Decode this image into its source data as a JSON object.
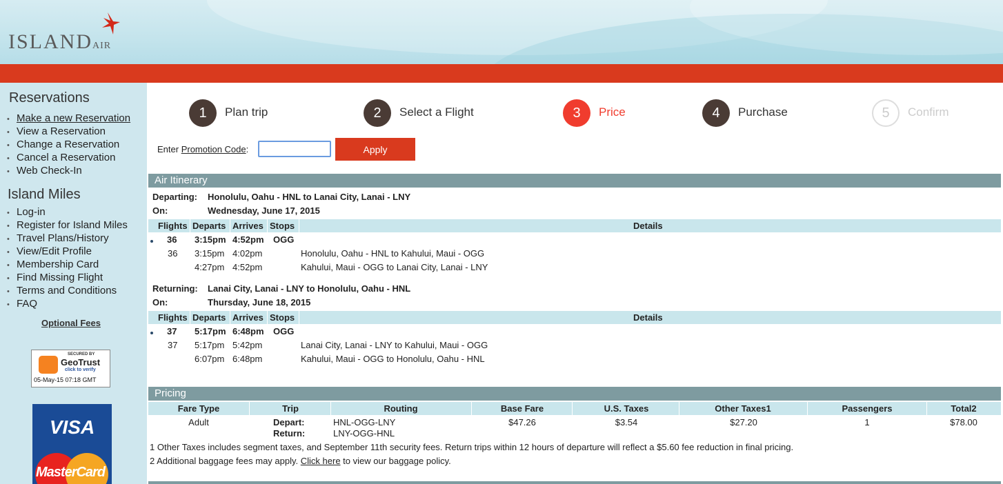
{
  "header": {
    "logo_main": "ISLAND",
    "logo_sub": "AIR"
  },
  "sidebar": {
    "reservations_heading": "Reservations",
    "reservations": [
      "Make a new Reservation",
      "View a Reservation",
      "Change a Reservation",
      "Cancel a Reservation",
      "Web Check-In"
    ],
    "miles_heading": "Island Miles",
    "miles": [
      "Log-in",
      "Register for Island Miles",
      "Travel Plans/History",
      "View/Edit Profile",
      "Membership Card",
      "Find Missing Flight",
      "Terms and Conditions",
      "FAQ"
    ],
    "optional_fees": "Optional Fees",
    "geotrust": {
      "top": "SECURED BY",
      "name": "GeoTrust",
      "verify": "click to verify",
      "date": "05-May-15 07:18 GMT"
    },
    "visa": "VISA",
    "mastercard": "MasterCard"
  },
  "steps": [
    {
      "num": "1",
      "label": "Plan trip",
      "state": "done"
    },
    {
      "num": "2",
      "label": "Select a Flight",
      "state": "done"
    },
    {
      "num": "3",
      "label": "Price",
      "state": "active"
    },
    {
      "num": "4",
      "label": "Purchase",
      "state": "done"
    },
    {
      "num": "5",
      "label": "Confirm",
      "state": "disabled"
    }
  ],
  "promo": {
    "label_prefix": "Enter ",
    "label_link": "Promotion Code",
    "label_suffix": ":",
    "value": "",
    "apply": "Apply"
  },
  "itinerary": {
    "heading": "Air Itinerary",
    "col_headers": {
      "flights": "Flights",
      "departs": "Departs",
      "arrives": "Arrives",
      "stops": "Stops",
      "details": "Details"
    },
    "departing": {
      "label": "Departing:",
      "route": "Honolulu, Oahu - HNL to Lanai City, Lanai - LNY",
      "on_label": "On:",
      "date": "Wednesday, June 17, 2015",
      "main": {
        "flight": "36",
        "departs": "3:15pm",
        "arrives": "4:52pm",
        "stops": "OGG"
      },
      "legs": [
        {
          "flight": "36",
          "departs": "3:15pm",
          "arrives": "4:02pm",
          "details": "Honolulu, Oahu - HNL to Kahului, Maui - OGG"
        },
        {
          "flight": "",
          "departs": "4:27pm",
          "arrives": "4:52pm",
          "details": "Kahului, Maui - OGG to Lanai City, Lanai - LNY"
        }
      ]
    },
    "returning": {
      "label": "Returning:",
      "route": "Lanai City, Lanai - LNY to Honolulu, Oahu - HNL",
      "on_label": "On:",
      "date": "Thursday, June 18, 2015",
      "main": {
        "flight": "37",
        "departs": "5:17pm",
        "arrives": "6:48pm",
        "stops": "OGG"
      },
      "legs": [
        {
          "flight": "37",
          "departs": "5:17pm",
          "arrives": "5:42pm",
          "details": "Lanai City, Lanai - LNY to Kahului, Maui - OGG"
        },
        {
          "flight": "",
          "departs": "6:07pm",
          "arrives": "6:48pm",
          "details": "Kahului, Maui - OGG to Honolulu, Oahu - HNL"
        }
      ]
    }
  },
  "pricing": {
    "heading": "Pricing",
    "headers": {
      "fare_type": "Fare Type",
      "trip": "Trip",
      "routing": "Routing",
      "base_fare": "Base Fare",
      "us_taxes": "U.S. Taxes",
      "other_taxes": "Other Taxes1",
      "passengers": "Passengers",
      "total": "Total2"
    },
    "row": {
      "fare_type": "Adult",
      "trip_depart": "Depart:",
      "trip_return": "Return:",
      "routing_depart": "HNL-OGG-LNY",
      "routing_return": "LNY-OGG-HNL",
      "base_fare": "$47.26",
      "us_taxes": "$3.54",
      "other_taxes": "$27.20",
      "passengers": "1",
      "total": "$78.00"
    },
    "note1": "1 Other Taxes includes segment taxes, and September 11th security fees. Return trips within 12 hours of departure will reflect a $5.60 fee reduction in final pricing.",
    "note2_prefix": "2 Additional baggage fees may apply. ",
    "note2_link": "Click here",
    "note2_suffix": " to view our baggage policy."
  },
  "colors": {
    "brand_red": "#d93a1e",
    "active_step": "#f03c2e",
    "step_dark": "#4a3b35",
    "section_bar": "#7e9ba0",
    "table_head": "#c9e6ec"
  }
}
